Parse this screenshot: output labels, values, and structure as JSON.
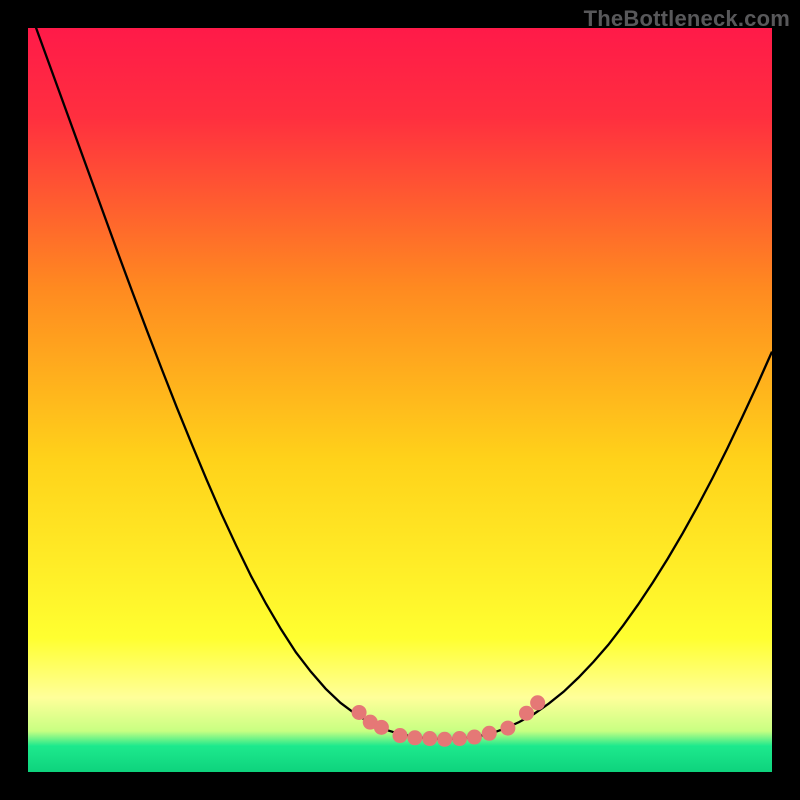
{
  "watermark": "TheBottleneck.com",
  "colors": {
    "frame_bg": "#000000",
    "grad_top": "#ff1a49",
    "grad_mid_upper": "#ff6e2b",
    "grad_mid": "#ffd21a",
    "grad_lightband": "#ffff9a",
    "grad_green": "#1de98d",
    "curve_stroke": "#000000",
    "marker_fill": "#e57876",
    "watermark_color": "#58585a"
  },
  "chart_data": {
    "type": "line",
    "title": "",
    "xlabel": "",
    "ylabel": "",
    "xlim": [
      0,
      100
    ],
    "ylim": [
      0,
      100
    ],
    "series": [
      {
        "name": "bottleneck-curve",
        "x": [
          0,
          2,
          4,
          6,
          8,
          10,
          12,
          14,
          16,
          18,
          20,
          22,
          24,
          26,
          28,
          30,
          32,
          34,
          36,
          38,
          40,
          42,
          44,
          46,
          48,
          50,
          52,
          54,
          56,
          58,
          60,
          62,
          64,
          66,
          68,
          70,
          72,
          74,
          76,
          78,
          80,
          82,
          84,
          86,
          88,
          90,
          92,
          94,
          96,
          98,
          100
        ],
        "y": [
          103,
          97.5,
          92.0,
          86.5,
          81.0,
          75.5,
          70.0,
          64.6,
          59.3,
          54.1,
          49.0,
          44.1,
          39.3,
          34.7,
          30.4,
          26.3,
          22.6,
          19.2,
          16.1,
          13.5,
          11.2,
          9.3,
          7.8,
          6.6,
          5.7,
          5.1,
          4.7,
          4.5,
          4.4,
          4.5,
          4.7,
          5.1,
          5.8,
          6.7,
          7.8,
          9.2,
          10.8,
          12.7,
          14.8,
          17.1,
          19.7,
          22.5,
          25.5,
          28.7,
          32.1,
          35.7,
          39.5,
          43.5,
          47.7,
          52.0,
          56.5
        ]
      }
    ],
    "markers": {
      "name": "highlighted-points",
      "points": [
        {
          "x": 44.5,
          "y": 8.0
        },
        {
          "x": 46.0,
          "y": 6.7
        },
        {
          "x": 47.5,
          "y": 6.0
        },
        {
          "x": 50.0,
          "y": 4.9
        },
        {
          "x": 52.0,
          "y": 4.6
        },
        {
          "x": 54.0,
          "y": 4.5
        },
        {
          "x": 56.0,
          "y": 4.4
        },
        {
          "x": 58.0,
          "y": 4.5
        },
        {
          "x": 60.0,
          "y": 4.7
        },
        {
          "x": 62.0,
          "y": 5.2
        },
        {
          "x": 64.5,
          "y": 5.9
        },
        {
          "x": 67.0,
          "y": 7.9
        },
        {
          "x": 68.5,
          "y": 9.3
        }
      ]
    },
    "gradient_stops": [
      {
        "offset": 0.0,
        "color": "#ff1a49"
      },
      {
        "offset": 0.12,
        "color": "#ff2f3f"
      },
      {
        "offset": 0.35,
        "color": "#ff8a20"
      },
      {
        "offset": 0.58,
        "color": "#ffd21a"
      },
      {
        "offset": 0.82,
        "color": "#ffff30"
      },
      {
        "offset": 0.9,
        "color": "#ffff9a"
      },
      {
        "offset": 0.945,
        "color": "#c8ff82"
      },
      {
        "offset": 0.965,
        "color": "#1de98d"
      },
      {
        "offset": 1.0,
        "color": "#0ed37d"
      }
    ]
  }
}
